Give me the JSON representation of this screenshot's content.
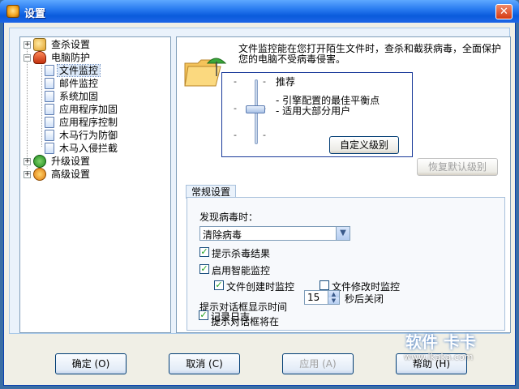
{
  "window": {
    "title": "设置"
  },
  "tree": {
    "items": [
      {
        "label": "查杀设置"
      },
      {
        "label": "电脑防护"
      },
      {
        "label": "文件监控"
      },
      {
        "label": "邮件监控"
      },
      {
        "label": "系统加固"
      },
      {
        "label": "应用程序加固"
      },
      {
        "label": "应用程序控制"
      },
      {
        "label": "木马行为防御"
      },
      {
        "label": "木马入侵拦截"
      },
      {
        "label": "升级设置"
      },
      {
        "label": "高级设置"
      }
    ]
  },
  "panel": {
    "description": "文件监控能在您打开陌生文件时，查杀和截获病毒，全面保护您的电脑不受病毒侵害。",
    "level": {
      "name": "推荐",
      "line1": "- 引擎配置的最佳平衡点",
      "line2": "- 适用大部分用户",
      "custom_button": "自定义级别",
      "restore_button": "恢复默认级别"
    },
    "group_tab": "常规设置",
    "on_virus_label": "发现病毒时：",
    "on_virus_value": "清除病毒",
    "show_result": "提示杀毒结果",
    "smart_monitor": "启用智能监控",
    "create_monitor": "文件创建时监控",
    "modify_monitor": "文件修改时监控",
    "dialog_time_title": "提示对话框显示时间",
    "dialog_prefix": "提示对话框将在",
    "dialog_seconds": "15",
    "dialog_suffix": "秒后关闭",
    "log": "记录日志"
  },
  "buttons": {
    "ok": "确定 (O)",
    "cancel": "取消 (C)",
    "apply": "应用 (A)",
    "help": "帮助 (H)"
  },
  "watermark": {
    "logo": "软件 卡卡",
    "url": "www.ikaka.com"
  }
}
